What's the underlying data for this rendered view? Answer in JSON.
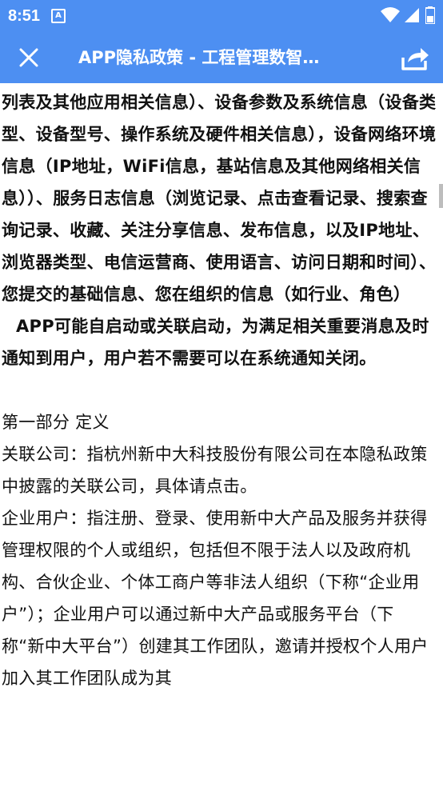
{
  "status_bar": {
    "time": "8:51",
    "notification_icon": "A",
    "icons": [
      "wifi-icon",
      "cellular-signal-icon",
      "battery-icon"
    ]
  },
  "app_bar": {
    "title": "APP隐私政策 - 工程管理数智…",
    "close_icon": "close-icon",
    "share_icon": "share-icon",
    "background": "#4d8ff2"
  },
  "document": {
    "para_info": "息）、应用信息（应用崩溃信息、通知开关状态、应用安装列表及其他应用相关信息）、设备参数及系统信息（设备类型、设备型号、操作系统及硬件相关信息），设备网络环境信息（IP地址，WiFi信息，基站信息及其他网络相关信息））、服务日志信息（浏览记录、点击查看记录、搜索查询记录、收藏、关注分享信息、发布信息，以及IP地址、浏览器类型、电信运营商、使用语言、访问日期和时间）、您提交的基础信息、您在组织的信息（如行业、角色）",
    "para_autostart": "APP可能自启动或关联启动，为满足相关重要消息及时通知到用户，用户若不需要可以在系统通知关闭。",
    "section_title": "第一部分 定义",
    "para_affiliate": "关联公司：指杭州新中大科技股份有限公司在本隐私政策中披露的关联公司，具体请点击。",
    "para_enterprise": "企业用户：指注册、登录、使用新中大产品及服务并获得管理权限的个人或组织，包括但不限于法人以及政府机构、合伙企业、个体工商户等非法人组织（下称“企业用户”）；企业用户可以通过新中大产品或服务平台（下称“新中大平台”）创建其工作团队，邀请并授权个人用户加入其工作团队成为其"
  }
}
